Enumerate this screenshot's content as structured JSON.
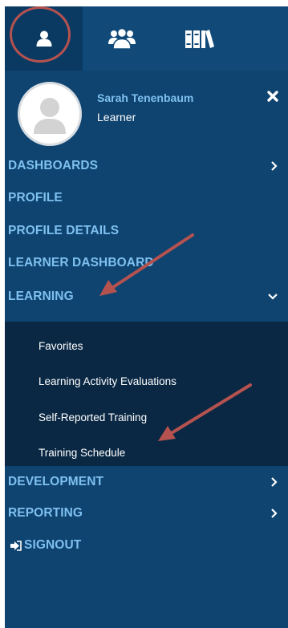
{
  "user": {
    "name": "Sarah Tenenbaum",
    "role": "Learner"
  },
  "nav": {
    "dashboards": "DASHBOARDS",
    "profile": "PROFILE",
    "profile_details": "PROFILE DETAILS",
    "learner_dashboard": "LEARNER DASHBOARD",
    "learning": "LEARNING",
    "development": "DEVELOPMENT",
    "reporting": "REPORTING",
    "signout": "SIGNOUT"
  },
  "learning_submenu": {
    "favorites": "Favorites",
    "evaluations": "Learning Activity Evaluations",
    "self_reported": "Self-Reported Training",
    "schedule": "Training Schedule"
  },
  "icons": {
    "tab1": "user-icon",
    "tab2": "users-group-icon",
    "tab3": "library-icon",
    "close": "close-icon",
    "signout": "sign-out-icon"
  },
  "colors": {
    "panel": "#0f4470",
    "submenu": "#0a2844",
    "link": "#7ec0f0",
    "annotation": "#b5524f"
  }
}
